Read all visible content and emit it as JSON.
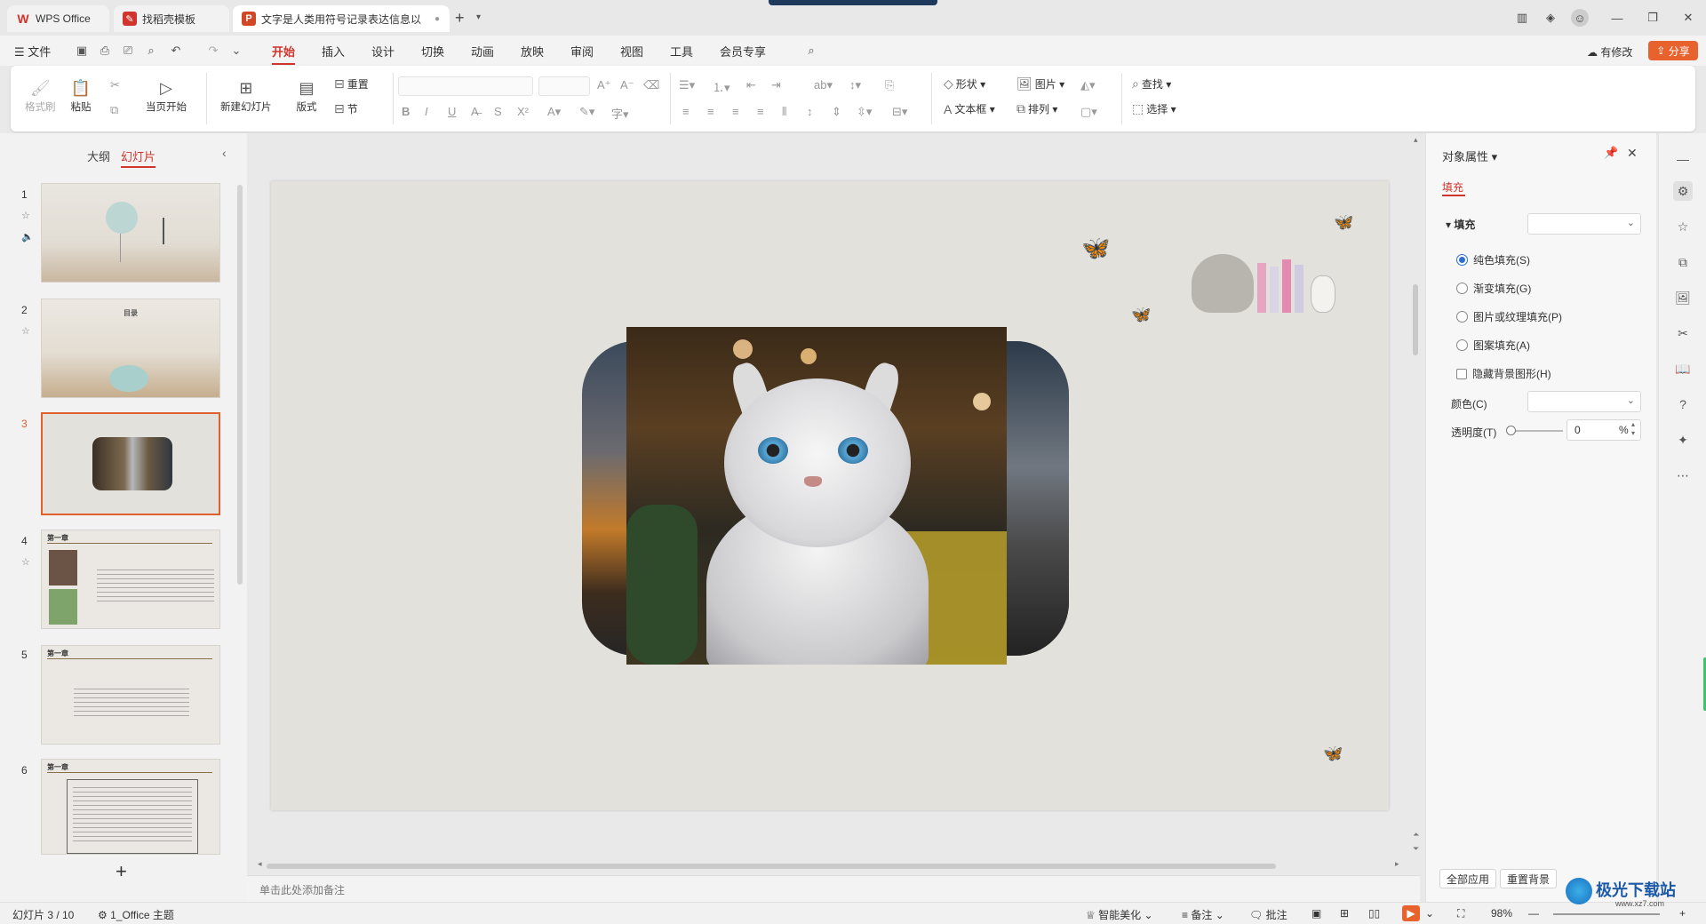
{
  "tabs": [
    {
      "label": "WPS Office",
      "icon": "wps-logo-icon",
      "color": "#d0342c"
    },
    {
      "label": "找稻壳模板",
      "icon": "docer-icon",
      "color": "#d0342c"
    },
    {
      "label": "文字是人类用符号记录表达信息以",
      "icon": "ppt-icon",
      "color": "#d24726"
    }
  ],
  "new_tab": "+",
  "menu": {
    "file": "文件",
    "items": [
      "开始",
      "插入",
      "设计",
      "切换",
      "动画",
      "放映",
      "审阅",
      "视图",
      "工具",
      "会员专享"
    ],
    "active": "开始",
    "has_edit": "有修改",
    "share": "分享"
  },
  "ribbon": {
    "format_painter": "格式刷",
    "paste": "粘贴",
    "from_current": "当页开始",
    "new_slide": "新建幻灯片",
    "layout": "版式",
    "reset": "重置",
    "section": "节",
    "shape": "形状",
    "picture": "图片",
    "textbox": "文本框",
    "arrange": "排列",
    "find": "查找",
    "select": "选择"
  },
  "left_panel": {
    "tab_outline": "大纲",
    "tab_slides": "幻灯片",
    "slides": [
      {
        "num": "1"
      },
      {
        "num": "2",
        "title": "目录"
      },
      {
        "num": "3"
      },
      {
        "num": "4",
        "heading": "第一章"
      },
      {
        "num": "5",
        "heading": "第一章"
      },
      {
        "num": "6",
        "heading": "第一章"
      }
    ],
    "add": "+"
  },
  "notes_placeholder": "单击此处添加备注",
  "right_panel": {
    "title": "对象属性",
    "tab": "填充",
    "section": "填充",
    "options": [
      "纯色填充(S)",
      "渐变填充(G)",
      "图片或纹理填充(P)",
      "图案填充(A)"
    ],
    "selected_option": "纯色填充(S)",
    "hide_bg": "隐藏背景图形(H)",
    "color_label": "颜色(C)",
    "transparency_label": "透明度(T)",
    "transparency_value": "0",
    "percent": "%",
    "apply_all": "全部应用",
    "reset_bg": "重置背景"
  },
  "status": {
    "slide_info": "幻灯片 3 / 10",
    "theme": "1_Office 主题",
    "beautify": "智能美化",
    "notes": "备注",
    "comments": "批注",
    "zoom": "98%"
  },
  "watermark": {
    "text": "极光下载站",
    "url": "www.xz7.com"
  },
  "colors": {
    "accent": "#d0342c",
    "selection": "#e0602b",
    "slide_bg": "#e3e1db"
  }
}
